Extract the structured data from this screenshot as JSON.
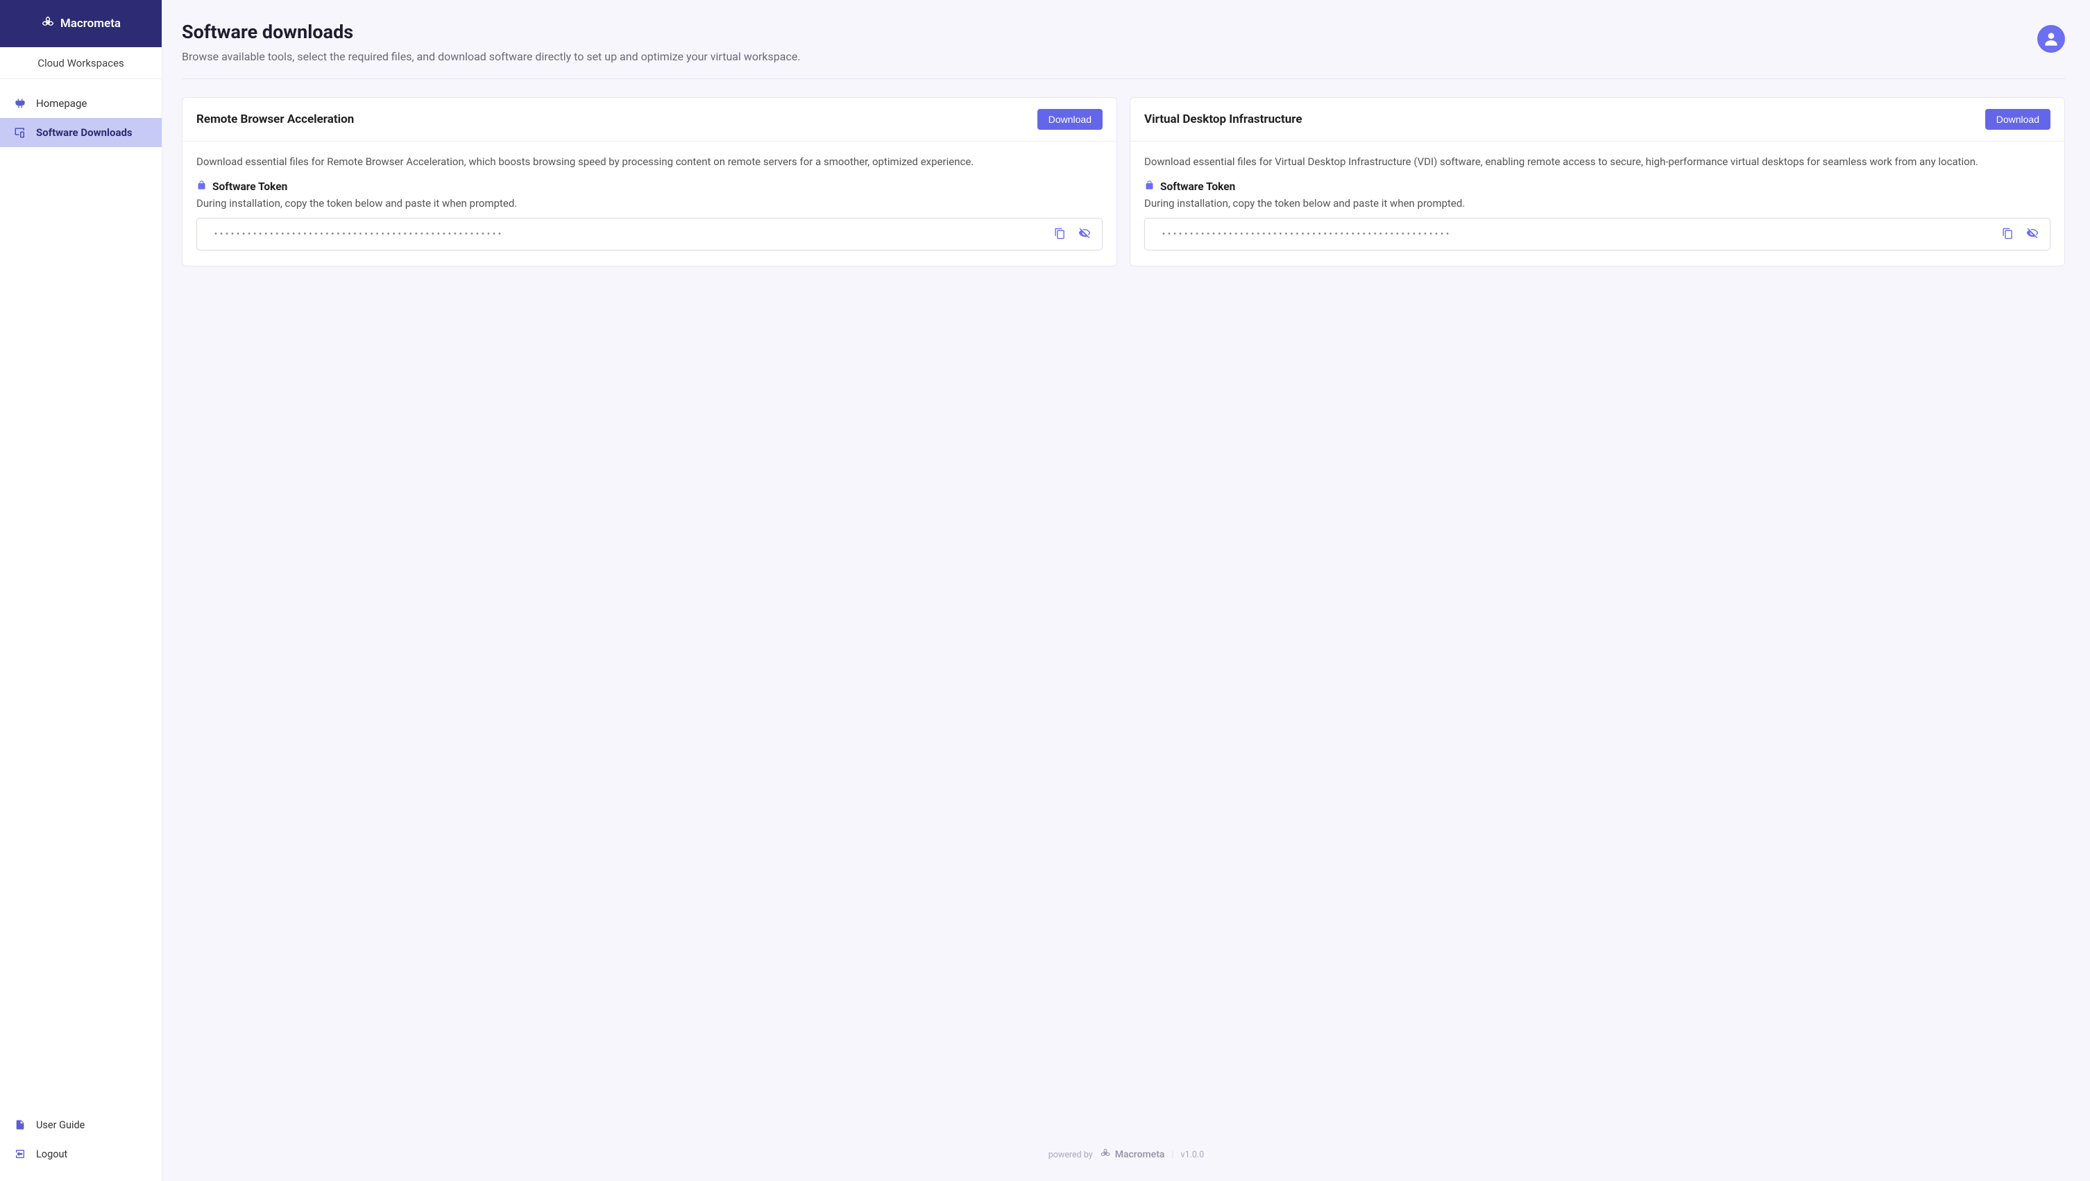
{
  "brand": {
    "name": "Macrometa"
  },
  "workspace_label": "Cloud Workspaces",
  "nav": {
    "items": [
      {
        "label": "Homepage",
        "icon": "home-icon",
        "active": false
      },
      {
        "label": "Software Downloads",
        "icon": "download-icon",
        "active": true
      }
    ]
  },
  "nav_bottom": {
    "items": [
      {
        "label": "User Guide",
        "icon": "book-icon"
      },
      {
        "label": "Logout",
        "icon": "logout-icon"
      }
    ]
  },
  "page": {
    "title": "Software downloads",
    "subtitle": "Browse available tools, select the required files, and download software directly to set up and optimize your virtual workspace."
  },
  "cards": [
    {
      "title": "Remote Browser Acceleration",
      "download_label": "Download",
      "description": "Download essential files for Remote Browser Acceleration, which boosts browsing speed by processing content on remote servers for a smoother, optimized experience.",
      "token_heading": "Software Token",
      "token_instruction": "During installation, copy the token below and paste it when prompted.",
      "token_masked": "••••••••••••••••••••••••••••••••••••••••••••••••••••"
    },
    {
      "title": "Virtual Desktop Infrastructure",
      "download_label": "Download",
      "description": "Download essential files for Virtual Desktop Infrastructure (VDI) software, enabling remote access to secure, high-performance virtual desktops for seamless work from any location.",
      "token_heading": "Software Token",
      "token_instruction": "During installation, copy the token below and paste it when prompted.",
      "token_masked": "••••••••••••••••••••••••••••••••••••••••••••••••••••"
    }
  ],
  "footer": {
    "powered_by": "powered by",
    "brand": "Macrometa",
    "version": "v1.0.0"
  }
}
